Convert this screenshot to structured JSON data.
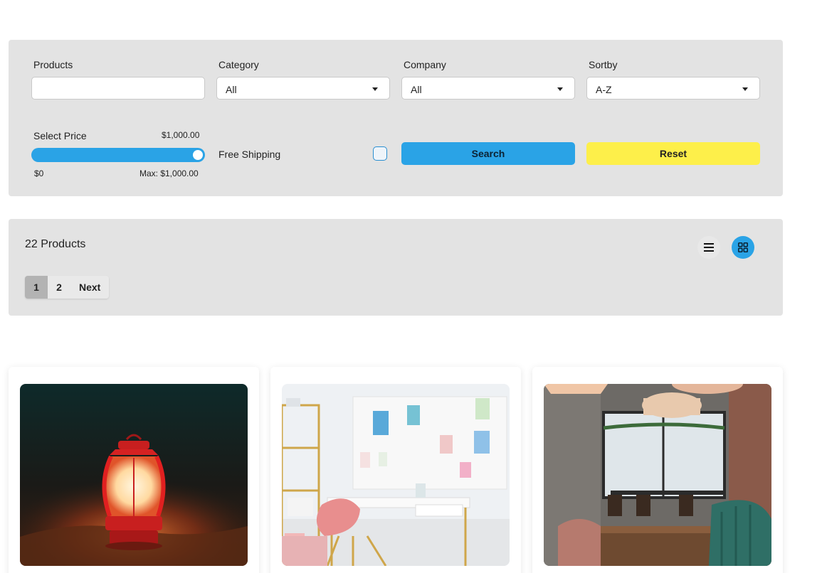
{
  "filters": {
    "products_label": "Products",
    "products_value": "",
    "category_label": "Category",
    "category_value": "All",
    "company_label": "Company",
    "company_value": "All",
    "sortby_label": "Sortby",
    "sortby_value": "A-Z",
    "price_label": "Select Price",
    "price_value": "$1,000.00",
    "price_min_label": "$0",
    "price_max_label": "Max: $1,000.00",
    "price_fraction": 1.0,
    "free_shipping_label": "Free Shipping",
    "free_shipping_checked": false,
    "search_label": "Search",
    "reset_label": "Reset"
  },
  "results": {
    "count_text": "22 Products",
    "view_list_icon": "list-icon",
    "view_grid_icon": "grid-icon",
    "active_view": "grid",
    "pagination": [
      "1",
      "2"
    ],
    "active_page": "1",
    "next_label": "Next"
  },
  "products": [
    {
      "image": "red-lantern-in-sand"
    },
    {
      "image": "white-desk-with-pegboard"
    },
    {
      "image": "cafe-interior-with-pendant-lamps"
    }
  ],
  "colors": {
    "panel_bg": "#e3e3e3",
    "accent_blue": "#2aa3e6",
    "reset_yellow": "#fdef4a"
  }
}
